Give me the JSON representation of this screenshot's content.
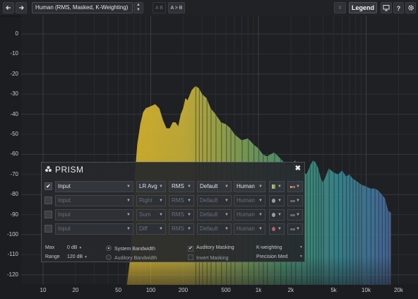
{
  "toolbar": {
    "back_icon": "arrow-left-icon",
    "forward_icon": "arrow-right-icon",
    "preset": "Human (RMS, Masked, K-Weighting)",
    "ab_label": "A  B",
    "a_to_b_label": "A > B",
    "pause_label": "II",
    "legend_label": "Legend",
    "help_label": "?"
  },
  "chart_data": {
    "type": "area",
    "title": "",
    "xlabel": "",
    "ylabel": "",
    "x_scale": "log",
    "xlim": [
      8,
      22000
    ],
    "ylim": [
      -125,
      5
    ],
    "x_ticks": [
      "10",
      "20",
      "50",
      "100",
      "200",
      "500",
      "1k",
      "2k",
      "5k",
      "10k",
      "20k"
    ],
    "y_ticks": [
      "0",
      "-10",
      "-20",
      "-30",
      "-40",
      "-50",
      "-60",
      "-70",
      "-80",
      "-90",
      "-100",
      "-110",
      "-120"
    ],
    "grid": true,
    "series": [
      {
        "x": [
          60,
          65,
          70,
          75,
          80,
          85,
          90,
          100,
          110,
          120,
          130,
          140,
          150,
          160,
          170,
          180,
          190,
          200,
          210,
          220,
          240,
          260,
          280,
          300,
          330,
          360,
          400,
          450,
          500,
          550,
          600,
          700,
          800,
          900,
          1000,
          1100,
          1200,
          1400,
          1600,
          1800,
          2000,
          2200,
          2500,
          2800,
          3000,
          3200,
          3400,
          3600,
          3800,
          4000,
          4500,
          5000,
          5500,
          6000,
          6500,
          7000,
          7500,
          8000,
          8500,
          9000,
          10000,
          11000,
          12000,
          13000,
          14000,
          15000,
          16000,
          17000
        ],
        "y": [
          -125,
          -110,
          -75,
          -55,
          -45,
          -39,
          -37,
          -36,
          -35,
          -37,
          -43,
          -47,
          -47,
          -44,
          -44,
          -46,
          -40,
          -37,
          -32,
          -33,
          -28,
          -26,
          -27,
          -30,
          -32,
          -37,
          -40,
          -44,
          -45,
          -47,
          -50,
          -53,
          -52,
          -55,
          -57,
          -60,
          -61,
          -59,
          -62,
          -65,
          -65,
          -63,
          -68,
          -70,
          -66,
          -63,
          -64,
          -67,
          -72,
          -74,
          -67,
          -69,
          -70,
          -68,
          -71,
          -70,
          -72,
          -73,
          -74,
          -75,
          -76,
          -77,
          -77,
          -78,
          -80,
          -82,
          -88,
          -89
        ]
      }
    ]
  },
  "prism": {
    "title": "PRISM",
    "rows": [
      {
        "input": "Input",
        "channel": "LR Avg",
        "mode": "RMS",
        "curve": "Default",
        "weight": "Human",
        "active": true
      },
      {
        "input": "Input",
        "channel": "Right",
        "mode": "RMS",
        "curve": "Default",
        "weight": "Human",
        "active": false
      },
      {
        "input": "Input",
        "channel": "Sum",
        "mode": "RMS",
        "curve": "Default",
        "weight": "Human",
        "active": false
      },
      {
        "input": "Input",
        "channel": "Diff",
        "mode": "RMS",
        "curve": "Default",
        "weight": "Human",
        "active": false
      }
    ],
    "check_mark": "✔",
    "max_label": "Max",
    "max_value": "0 dB",
    "range_label": "Range",
    "range_value": "120 dB",
    "system_bandwidth": "System Bandwidth",
    "auditory_bandwidth": "Auditory Bandwidth",
    "auditory_masking": "Auditory Masking",
    "invert_masking": "Invert Masking",
    "weighting": "K-weighting",
    "precision": "Precision Med",
    "colors": {
      "row1": "#e8c030",
      "row2": "#9a9ea4",
      "row3": "#9a9ea4",
      "row4": "#b06060"
    }
  }
}
